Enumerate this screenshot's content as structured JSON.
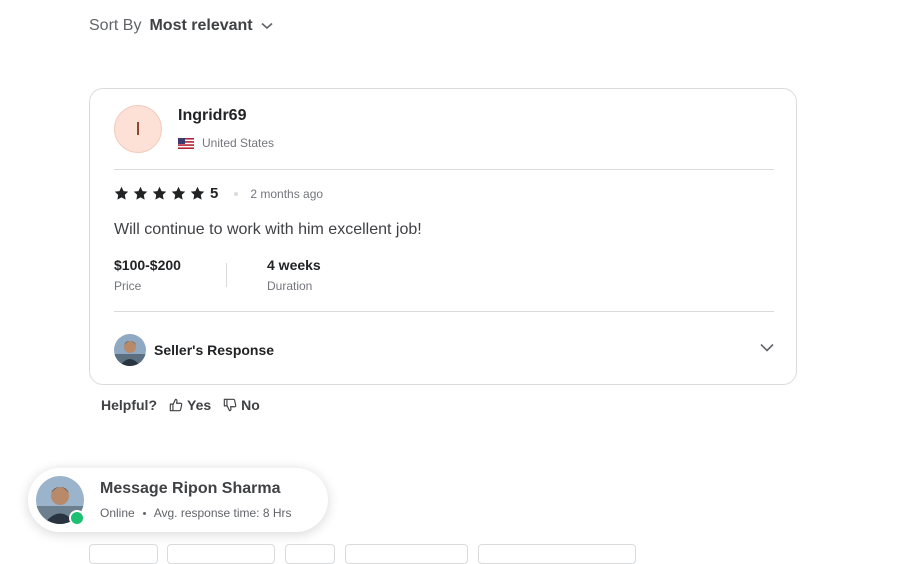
{
  "sort": {
    "label": "Sort By",
    "value": "Most relevant",
    "icon": "chevron-down-icon"
  },
  "review": {
    "reviewer_initial": "I",
    "reviewer_name": "Ingridr69",
    "country": "United States",
    "country_flag_icon": "us-flag-icon",
    "rating": "5",
    "stars": 5,
    "time_ago": "2 months ago",
    "text": "Will continue to work with him excellent job!",
    "price_value": "$100-$200",
    "price_label": "Price",
    "duration_value": "4 weeks",
    "duration_label": "Duration",
    "seller_response_label": "Seller's Response"
  },
  "helpful": {
    "label": "Helpful?",
    "yes": "Yes",
    "no": "No"
  },
  "message": {
    "title": "Message Ripon Sharma",
    "status": "Online",
    "response_time": "Avg. response time: 8 Hrs"
  },
  "colors": {
    "accent_online": "#1dbf73",
    "avatar_bg": "#fde0d6",
    "border": "#dadbdd",
    "text_primary": "#222325",
    "text_secondary": "#74767e"
  }
}
